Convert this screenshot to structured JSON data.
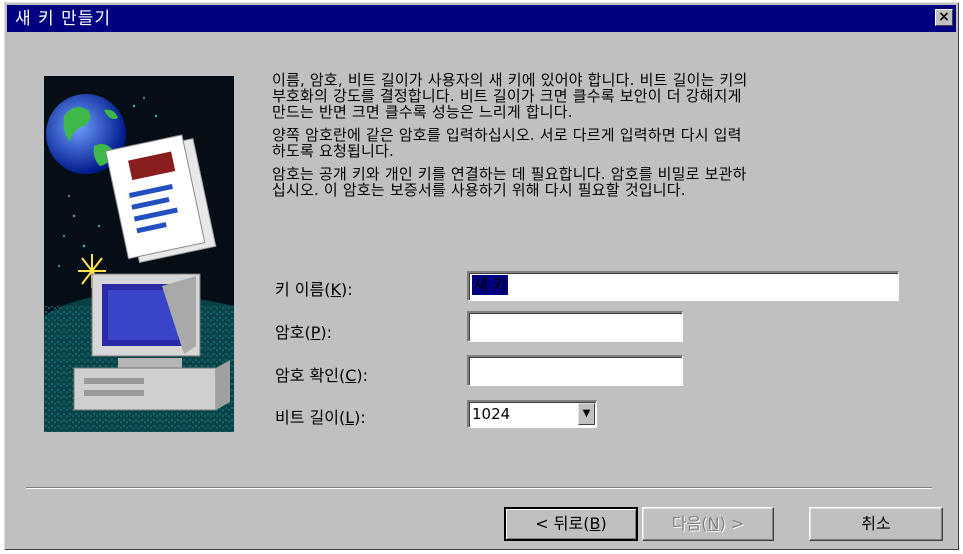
{
  "window": {
    "title": "새 키 만들기",
    "close_glyph": "×"
  },
  "description": {
    "lines": [
      "이름, 암호, 비트 길이가 사용자의 새 키에 있어야 합니다. 비트 길이는 키의",
      "부호화의 강도를 결정합니다. 비트 길이가 크면 클수록 보안이 더 강해지게",
      "만드는 반면 크면 클수록 성능은 느리게 합니다.",
      "양쪽 암호란에 같은 암호를 입력하십시오. 서로 다르게 입력하면 다시 입력",
      "하도록 요청됩니다.",
      "암호는 공개 키와 개인 키를  연결하는 데 필요합니다. 암호를 비밀로 보관하",
      "십시오. 이 암호는 보증서를 사용하기 위해 다시 필요할 것입니다."
    ]
  },
  "form": {
    "key_name": {
      "label_pre": "키 이름(",
      "label_key": "K",
      "label_post": "):",
      "value": "새 키"
    },
    "password": {
      "label_pre": "암호(",
      "label_key": "P",
      "label_post": "):",
      "value": ""
    },
    "confirm": {
      "label_pre": "암호 확인(",
      "label_key": "C",
      "label_post": "):",
      "value": ""
    },
    "bit_length": {
      "label_pre": "비트 길이(",
      "label_key": "L",
      "label_post": "):",
      "value": "1024",
      "arrow": "▼"
    }
  },
  "buttons": {
    "back": {
      "pre": "< 뒤로(",
      "key": "B",
      "post": ")"
    },
    "next": {
      "pre": "다음(",
      "key": "N",
      "post": ") >"
    },
    "cancel": "취소"
  },
  "icons": [
    "close-icon",
    "wizard-illustration",
    "dropdown-arrow-icon"
  ],
  "colors": {
    "titlebar": "#000080",
    "face": "#c0c0c0",
    "selection": "#000080"
  }
}
